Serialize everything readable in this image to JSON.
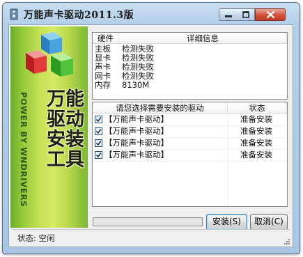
{
  "window": {
    "title": "万能声卡驱动2011.3版"
  },
  "banner": {
    "power_text": "POWER BY WNDRIVERS",
    "big_text": "万能驱动安装工具",
    "logo": "colored-cubes-logo"
  },
  "hardware_table": {
    "headers": [
      "硬件",
      "详细信息"
    ],
    "rows": [
      {
        "type": "主板",
        "info": "检测失败"
      },
      {
        "type": "显卡",
        "info": "检测失败"
      },
      {
        "type": "声卡",
        "info": "检测失败"
      },
      {
        "type": "网卡",
        "info": "检测失败"
      },
      {
        "type": "内存",
        "info": "8130M"
      }
    ]
  },
  "driver_table": {
    "headers": [
      "请您选择需要安装的驱动",
      "状态"
    ],
    "rows": [
      {
        "name": "【万能声卡驱动】",
        "status": "准备安装",
        "checked": true
      },
      {
        "name": "【万能声卡驱动】",
        "status": "准备安装",
        "checked": true
      },
      {
        "name": "【万能声卡驱动】",
        "status": "准备安装",
        "checked": true
      },
      {
        "name": "【万能声卡驱动】",
        "status": "准备安装",
        "checked": true
      }
    ]
  },
  "progress": {
    "value": 0
  },
  "buttons": {
    "install": "安装(S)",
    "cancel": "取消(C)"
  },
  "status_bar": {
    "text": "状态: 空闲"
  },
  "colors": {
    "banner_green": "#9ccc3e",
    "close_red": "#d4503a",
    "frame_blue": "#b4cfe8"
  }
}
